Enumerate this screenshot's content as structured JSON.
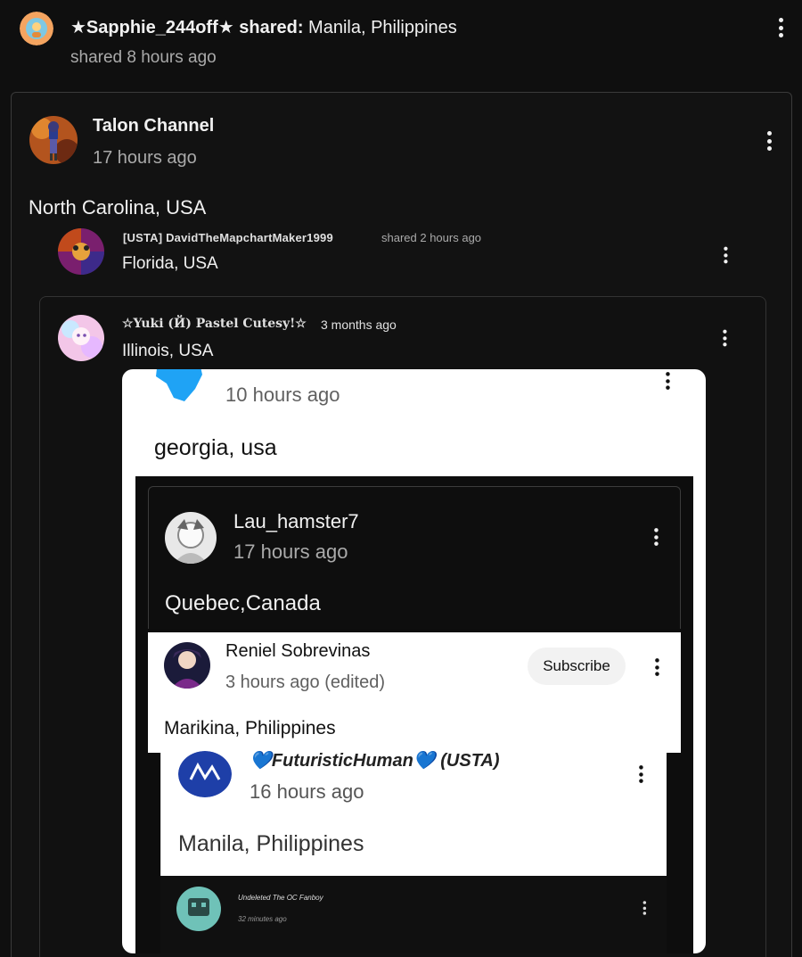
{
  "share": {
    "user": "★Sapphie_244off★",
    "action": " shared: ",
    "location": "Manila, Philippines",
    "time": "shared 8 hours ago"
  },
  "talon": {
    "name": "Talon Channel",
    "time": "17 hours ago",
    "text": "North Carolina, USA"
  },
  "david": {
    "name": "[USTA] DavidTheMapchartMaker1999",
    "shared": "shared 2 hours ago",
    "text": "Florida, USA"
  },
  "yuki": {
    "name": "☆Yuki (Й) Pastel Cutesy!☆",
    "time": "3 months ago",
    "text": "Illinois, USA"
  },
  "embed": {
    "top_time": "10 hours ago",
    "top_text": "georgia, usa",
    "lau": {
      "name": "Lau_hamster7",
      "time": "17 hours ago",
      "text": "Quebec,Canada"
    },
    "reniel": {
      "name": "Reniel Sobrevinas",
      "time": "3 hours ago (edited)",
      "subscribe": "Subscribe",
      "text": "Marikina, Philippines"
    },
    "futuristic": {
      "name": "💙FuturisticHuman💙 (USTA)",
      "time": "16 hours ago",
      "text": "Manila, Philippines"
    },
    "undeleted": {
      "name": "Undeleted The OC Fanboy",
      "time": "32 minutes ago"
    }
  },
  "colors": {
    "background": "#0f0f0f",
    "text_primary": "#f1f1f1",
    "text_secondary": "#aaaaaa",
    "card_border": "#3a3a3a"
  },
  "icons": [
    "more-vert-icon",
    "avatar"
  ]
}
